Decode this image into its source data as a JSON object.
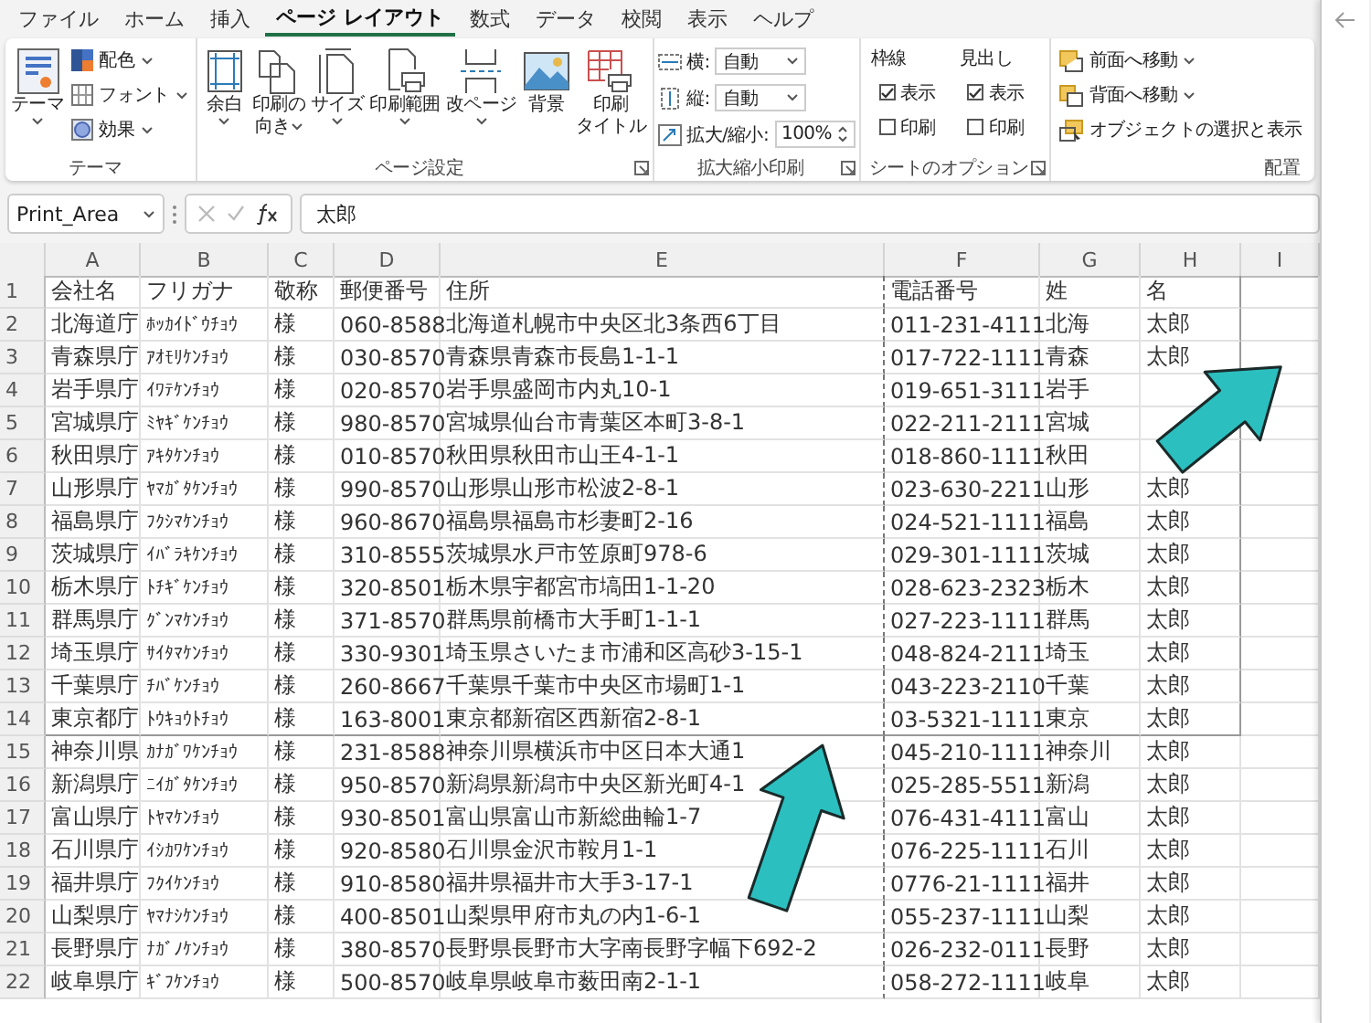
{
  "ribbon_tabs": [
    {
      "label": "ファイル",
      "selected": false
    },
    {
      "label": "ホーム",
      "selected": false
    },
    {
      "label": "挿入",
      "selected": false
    },
    {
      "label": "ページ レイアウト",
      "selected": true
    },
    {
      "label": "数式",
      "selected": false
    },
    {
      "label": "データ",
      "selected": false
    },
    {
      "label": "校閲",
      "selected": false
    },
    {
      "label": "表示",
      "selected": false
    },
    {
      "label": "ヘルプ",
      "selected": false
    }
  ],
  "theme_group": {
    "label": "テーマ",
    "main_button": "テーマ",
    "items": [
      "配色",
      "フォント",
      "効果"
    ]
  },
  "page_setup_group": {
    "label": "ページ設定",
    "buttons": [
      {
        "lines": [
          "余白"
        ],
        "has_menu": true
      },
      {
        "lines": [
          "印刷の",
          "向き"
        ],
        "has_menu": true
      },
      {
        "lines": [
          "サイズ"
        ],
        "has_menu": true
      },
      {
        "lines": [
          "印刷範囲"
        ],
        "has_menu": true
      },
      {
        "lines": [
          "改ページ"
        ],
        "has_menu": true
      },
      {
        "lines": [
          "背景"
        ],
        "has_menu": false
      },
      {
        "lines": [
          "印刷",
          "タイトル"
        ],
        "has_menu": false
      }
    ]
  },
  "scale_group": {
    "label": "拡大縮小印刷",
    "fields": [
      {
        "label": "横:",
        "value": "自動"
      },
      {
        "label": "縦:",
        "value": "自動"
      }
    ],
    "zoom": {
      "label": "拡大/縮小:",
      "value": "100%"
    }
  },
  "sheet_options_group": {
    "label": "シートのオプション",
    "columns": [
      {
        "title": "枠線",
        "options": [
          {
            "label": "表示",
            "checked": true
          },
          {
            "label": "印刷",
            "checked": false
          }
        ]
      },
      {
        "title": "見出し",
        "options": [
          {
            "label": "表示",
            "checked": true
          },
          {
            "label": "印刷",
            "checked": false
          }
        ]
      }
    ]
  },
  "arrange_group": {
    "label": "配置",
    "items": [
      {
        "label": "前面へ移動",
        "has_menu": true
      },
      {
        "label": "背面へ移動",
        "has_menu": true
      },
      {
        "label": "オブジェクトの選択と表示",
        "has_menu": false
      }
    ]
  },
  "formula_bar": {
    "name_box": "Print_Area",
    "value": "太郎"
  },
  "sheet": {
    "columns": [
      "A",
      "B",
      "C",
      "D",
      "E",
      "F",
      "G",
      "H",
      "I"
    ],
    "rows": [
      {
        "number": "1",
        "cells": [
          "会社名",
          "フリガナ",
          "敬称",
          "郵便番号",
          "住所",
          "電話番号",
          "姓",
          "名"
        ]
      },
      {
        "number": "2",
        "cells": [
          "北海道庁",
          "ﾎｯｶｲﾄﾞｳﾁｮｳ",
          "様",
          "060-8588",
          "北海道札幌市中央区北3条西6丁目",
          "011-231-4111",
          "北海",
          "太郎"
        ]
      },
      {
        "number": "3",
        "cells": [
          "青森県庁",
          "ｱｵﾓﾘｹﾝﾁｮｳ",
          "様",
          "030-8570",
          "青森県青森市長島1-1-1",
          "017-722-1111",
          "青森",
          "太郎"
        ]
      },
      {
        "number": "4",
        "cells": [
          "岩手県庁",
          "ｲﾜﾃｹﾝﾁｮｳ",
          "様",
          "020-8570",
          "岩手県盛岡市内丸10-1",
          "019-651-3111",
          "岩手",
          null
        ]
      },
      {
        "number": "5",
        "cells": [
          "宮城県庁",
          "ﾐﾔｷﾞｹﾝﾁｮｳ",
          "様",
          "980-8570",
          "宮城県仙台市青葉区本町3-8-1",
          "022-211-2111",
          "宮城",
          null
        ]
      },
      {
        "number": "6",
        "cells": [
          "秋田県庁",
          "ｱｷﾀｹﾝﾁｮｳ",
          "様",
          "010-8570",
          "秋田県秋田市山王4-1-1",
          "018-860-1111",
          "秋田",
          null
        ]
      },
      {
        "number": "7",
        "cells": [
          "山形県庁",
          "ﾔﾏｶﾞﾀｹﾝﾁｮｳ",
          "様",
          "990-8570",
          "山形県山形市松波2-8-1",
          "023-630-2211",
          "山形",
          "太郎"
        ]
      },
      {
        "number": "8",
        "cells": [
          "福島県庁",
          "ﾌｸｼﾏｹﾝﾁｮｳ",
          "様",
          "960-8670",
          "福島県福島市杉妻町2-16",
          "024-521-1111",
          "福島",
          "太郎"
        ]
      },
      {
        "number": "9",
        "cells": [
          "茨城県庁",
          "ｲﾊﾞﾗｷｹﾝﾁｮｳ",
          "様",
          "310-8555",
          "茨城県水戸市笠原町978-6",
          "029-301-1111",
          "茨城",
          "太郎"
        ]
      },
      {
        "number": "10",
        "cells": [
          "栃木県庁",
          "ﾄﾁｷﾞｹﾝﾁｮｳ",
          "様",
          "320-8501",
          "栃木県宇都宮市塙田1-1-20",
          "028-623-2323",
          "栃木",
          "太郎"
        ]
      },
      {
        "number": "11",
        "cells": [
          "群馬県庁",
          "ｸﾞﾝﾏｹﾝﾁｮｳ",
          "様",
          "371-8570",
          "群馬県前橋市大手町1-1-1",
          "027-223-1111",
          "群馬",
          "太郎"
        ]
      },
      {
        "number": "12",
        "cells": [
          "埼玉県庁",
          "ｻｲﾀﾏｹﾝﾁｮｳ",
          "様",
          "330-9301",
          "埼玉県さいたま市浦和区高砂3-15-1",
          "048-824-2111",
          "埼玉",
          "太郎"
        ]
      },
      {
        "number": "13",
        "cells": [
          "千葉県庁",
          "ﾁﾊﾞｹﾝﾁｮｳ",
          "様",
          "260-8667",
          "千葉県千葉市中央区市場町1-1",
          "043-223-2110",
          "千葉",
          "太郎"
        ]
      },
      {
        "number": "14",
        "cells": [
          "東京都庁",
          "ﾄｳｷｮｳﾄﾁｮｳ",
          "様",
          "163-8001",
          "東京都新宿区西新宿2-8-1",
          "03-5321-1111",
          "東京",
          "太郎"
        ]
      },
      {
        "number": "15",
        "cells": [
          "神奈川県",
          "ｶﾅｶﾞﾜｹﾝﾁｮｳ",
          "様",
          "231-8588",
          "神奈川県横浜市中区日本大通1",
          "045-210-1111",
          "神奈川",
          "太郎"
        ]
      },
      {
        "number": "16",
        "cells": [
          "新潟県庁",
          "ﾆｲｶﾞﾀｹﾝﾁｮｳ",
          "様",
          "950-8570",
          "新潟県新潟市中央区新光町4-1",
          "025-285-5511",
          "新潟",
          "太郎"
        ]
      },
      {
        "number": "17",
        "cells": [
          "富山県庁",
          "ﾄﾔﾏｹﾝﾁｮｳ",
          "様",
          "930-8501",
          "富山県富山市新総曲輪1-7",
          "076-431-4111",
          "富山",
          "太郎"
        ]
      },
      {
        "number": "18",
        "cells": [
          "石川県庁",
          "ｲｼｶﾜｹﾝﾁｮｳ",
          "様",
          "920-8580",
          "石川県金沢市鞍月1-1",
          "076-225-1111",
          "石川",
          "太郎"
        ]
      },
      {
        "number": "19",
        "cells": [
          "福井県庁",
          "ﾌｸｲｹﾝﾁｮｳ",
          "様",
          "910-8580",
          "福井県福井市大手3-17-1",
          "0776-21-1111",
          "福井",
          "太郎"
        ]
      },
      {
        "number": "20",
        "cells": [
          "山梨県庁",
          "ﾔﾏﾅｼｹﾝﾁｮｳ",
          "様",
          "400-8501",
          "山梨県甲府市丸の内1-6-1",
          "055-237-1111",
          "山梨",
          "太郎"
        ]
      },
      {
        "number": "21",
        "cells": [
          "長野県庁",
          "ﾅｶﾞﾉｹﾝﾁｮｳ",
          "様",
          "380-8570",
          "長野県長野市大字南長野字幅下692-2",
          "026-232-0111",
          "長野",
          "太郎"
        ]
      },
      {
        "number": "22",
        "cells": [
          "岐阜県庁",
          "ｷﾞﾌｹﾝﾁｮｳ",
          "様",
          "500-8570",
          "岐阜県岐阜市薮田南2-1-1",
          "058-272-1111",
          "岐阜",
          "太郎"
        ]
      }
    ]
  }
}
